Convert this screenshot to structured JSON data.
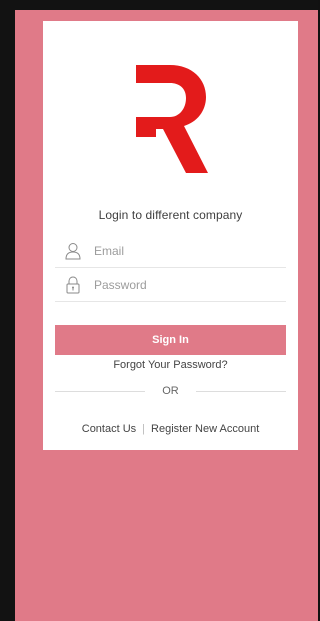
{
  "colors": {
    "accent": "#e07a88",
    "logo_red": "#e31b1b",
    "card_bg": "#ffffff"
  },
  "header": {
    "title": "Login to different company"
  },
  "form": {
    "email": {
      "value": "",
      "placeholder": "Email",
      "icon": "user-icon"
    },
    "password": {
      "value": "",
      "placeholder": "Password",
      "icon": "lock-icon"
    },
    "signin_label": "Sign In",
    "forgot_label": "Forgot Your Password?",
    "or_label": "OR"
  },
  "footer": {
    "contact_label": "Contact Us",
    "separator": "|",
    "register_label": "Register New Account"
  }
}
